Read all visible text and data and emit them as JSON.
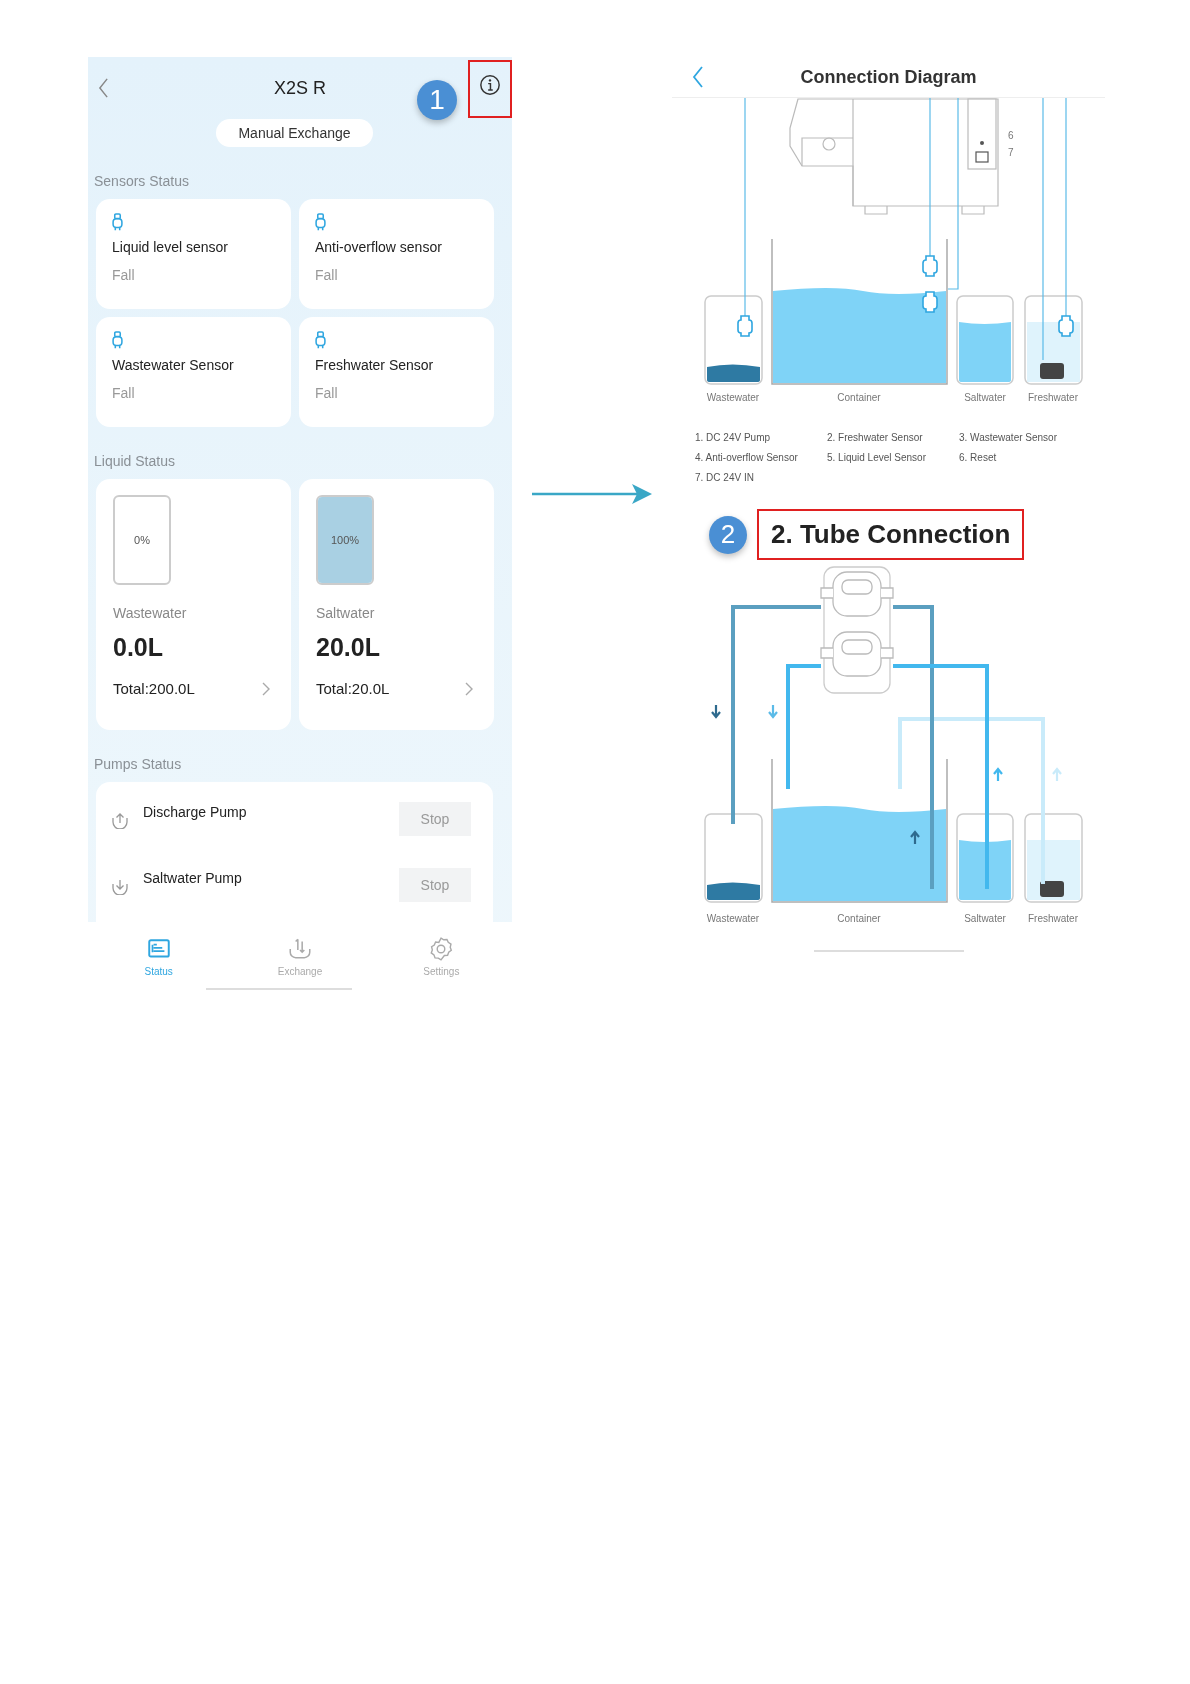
{
  "app_screen": {
    "title": "X2S R",
    "step_badge": "1",
    "manual_exchange_button": "Manual Exchange",
    "sensors_title": "Sensors Status",
    "sensors": [
      {
        "name": "Liquid level sensor",
        "state": "Fall"
      },
      {
        "name": "Anti-overflow sensor",
        "state": "Fall"
      },
      {
        "name": "Wastewater Sensor",
        "state": "Fall"
      },
      {
        "name": "Freshwater Sensor",
        "state": "Fall"
      }
    ],
    "liquid_title": "Liquid Status",
    "tanks": [
      {
        "name": "Wastewater",
        "percent": "0%",
        "level": 0,
        "volume": "0.0L",
        "total": "Total:200.0L"
      },
      {
        "name": "Saltwater",
        "percent": "100%",
        "level": 1,
        "volume": "20.0L",
        "total": "Total:20.0L"
      }
    ],
    "pumps_title": "Pumps Status",
    "pumps": [
      {
        "name": "Discharge Pump",
        "kind": "discharge",
        "button": "Stop"
      },
      {
        "name": "Saltwater Pump",
        "kind": "intake",
        "button": "Stop"
      }
    ],
    "tabs": [
      {
        "label": "Status",
        "kind": "status",
        "selected": true
      },
      {
        "label": "Exchange",
        "kind": "exchange",
        "selected": false
      },
      {
        "label": "Settings",
        "kind": "settings",
        "selected": false
      }
    ]
  },
  "diagram_screen": {
    "title": "Connection Diagram",
    "port_labels": [
      "6",
      "7"
    ],
    "vessel_labels": [
      "Wastewater",
      "Container",
      "Saltwater",
      "Freshwater"
    ],
    "legend": [
      "1. DC 24V Pump",
      "2. Freshwater Sensor",
      "3. Wastewater Sensor",
      "4. Anti-overflow Sensor",
      "5. Liquid Level Sensor",
      "6. Reset",
      "7. DC 24V IN"
    ],
    "step_badge": "2",
    "section_title": "2. Tube Connection",
    "tube_vessel_labels": [
      "Wastewater",
      "Container",
      "Saltwater",
      "Freshwater"
    ]
  }
}
